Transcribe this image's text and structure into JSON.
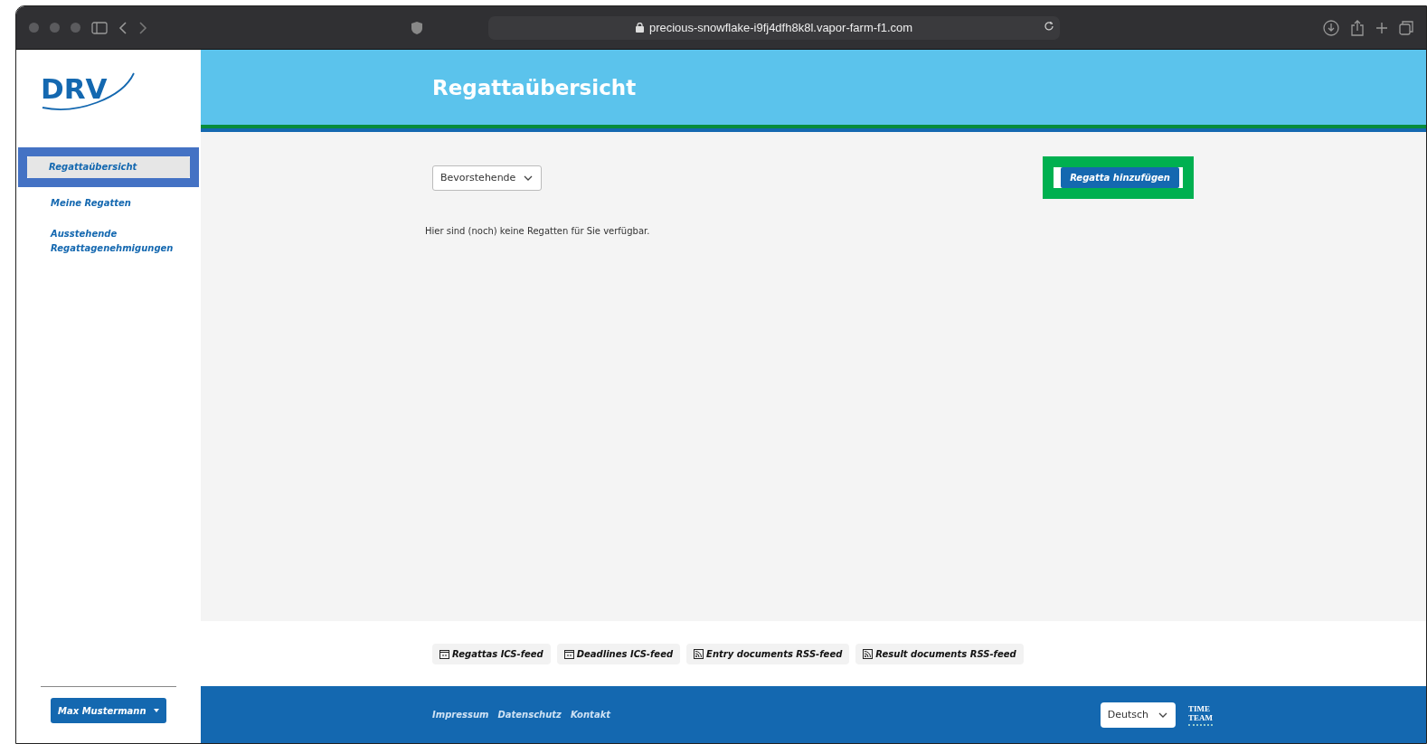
{
  "browser": {
    "url": "precious-snowflake-i9fj4dfh8k8l.vapor-farm-f1.com"
  },
  "sidebar": {
    "logo": "DRV",
    "items": [
      {
        "label": "Regattaübersicht",
        "selected": true,
        "highlighted": true
      },
      {
        "label": "Meine Regatten",
        "selected": false
      },
      {
        "label": "Ausstehende Regattagenehmigungen",
        "selected": false
      }
    ],
    "user_button": "Max Mustermann"
  },
  "header": {
    "title": "Regattaübersicht"
  },
  "filter": {
    "value": "Bevorstehende"
  },
  "add_button": {
    "label": "Regatta hinzufügen",
    "highlighted": true
  },
  "empty_message": "Hier sind (noch) keine Regatten für Sie verfügbar.",
  "feeds": [
    {
      "label": "Regattas ICS-feed",
      "kind": "calendar"
    },
    {
      "label": "Deadlines ICS-feed",
      "kind": "calendar"
    },
    {
      "label": "Entry documents RSS-feed",
      "kind": "rss"
    },
    {
      "label": "Result documents RSS-feed",
      "kind": "rss"
    }
  ],
  "footer": {
    "links": [
      "Impressum",
      "Datenschutz",
      "Kontakt"
    ],
    "language": "Deutsch",
    "logo_lines": [
      "TIME",
      "TEAM"
    ]
  }
}
